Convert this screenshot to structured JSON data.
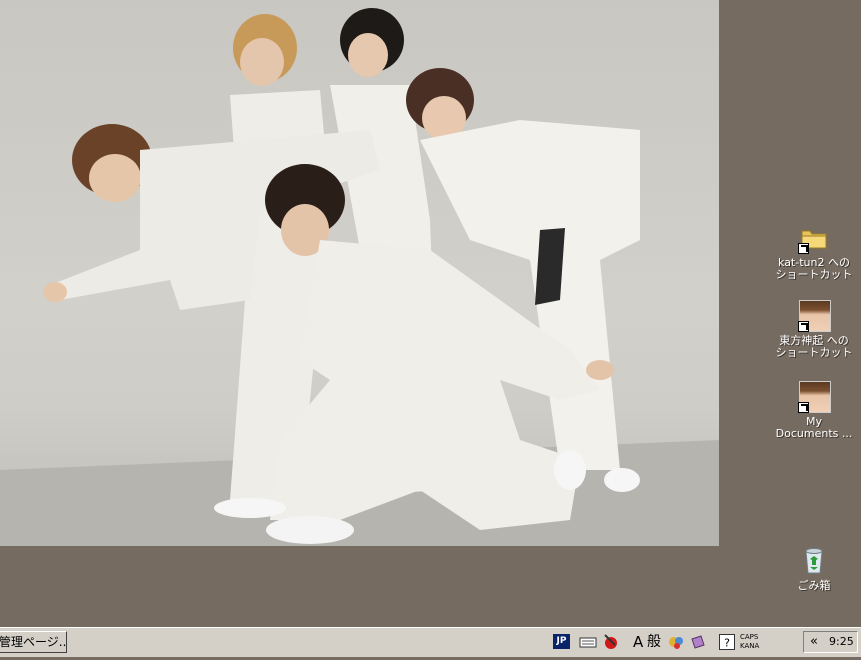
{
  "desktop": {
    "background_color": "#766b61",
    "icons": [
      {
        "label": "kat-tun2 へのショートカット",
        "icon": "folder-icon"
      },
      {
        "label": "東方神起 へのショートカット",
        "icon": "photo-icon"
      },
      {
        "label": "My Documents ...",
        "icon": "photo-icon"
      },
      {
        "label": "ごみ箱",
        "icon": "recycle-bin-icon"
      }
    ]
  },
  "taskbar": {
    "task_button_label": "管理ページ...",
    "ime": {
      "language": "JP",
      "input_mode": "A",
      "conversion_mode": "般"
    },
    "caps_label": "CAPS",
    "kana_label": "KANA",
    "tray_expand": "«",
    "clock": "9:25"
  },
  "colors": {
    "taskbar": "#d4d0c8",
    "ime_badge": "#0a246a"
  }
}
